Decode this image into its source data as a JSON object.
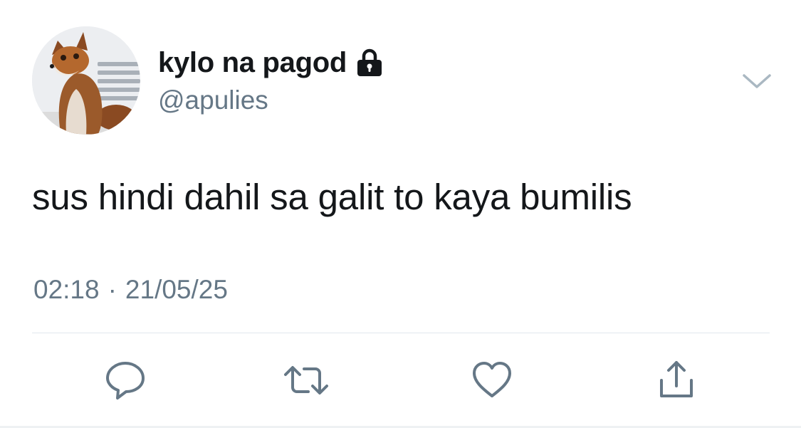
{
  "user": {
    "display_name": "kylo na pagod",
    "handle": "@apulies",
    "protected_icon": "lock-icon",
    "avatar": "fox-avatar"
  },
  "tweet": {
    "text": "sus hindi dahil sa galit to kaya bumilis",
    "time": "02:18",
    "separator": "·",
    "date": "21/05/25"
  },
  "actions": [
    {
      "name": "reply",
      "icon": "speech-bubble-icon"
    },
    {
      "name": "retweet",
      "icon": "retweet-arrows-icon"
    },
    {
      "name": "like",
      "icon": "heart-icon"
    },
    {
      "name": "share",
      "icon": "share-upload-icon"
    }
  ],
  "menu": {
    "icon": "chevron-down-icon"
  },
  "colors": {
    "text_primary": "#14171a",
    "text_secondary": "#657786",
    "icon_gray": "#657786",
    "divider": "#e1e8ed",
    "background": "#ffffff"
  }
}
